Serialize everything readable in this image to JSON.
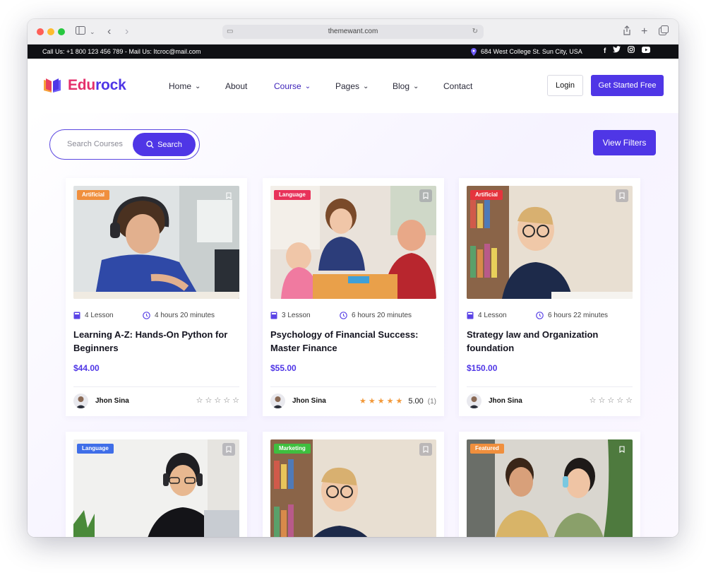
{
  "browser": {
    "url": "themewant.com"
  },
  "topbar": {
    "contact": "Call Us: +1 800 123 456 789 - Mail Us: Itcroc@mail.com",
    "address": "684 West College St. Sun City, USA",
    "social": [
      "f",
      "t",
      "ig",
      "yt"
    ]
  },
  "logo": {
    "text_a": "Edu",
    "text_b": "rock",
    "color_a": "#e42f6b",
    "color_b": "#4f36e6"
  },
  "nav": [
    {
      "label": "Home",
      "dropdown": true
    },
    {
      "label": "About",
      "dropdown": false
    },
    {
      "label": "Course",
      "dropdown": true,
      "active": true
    },
    {
      "label": "Pages",
      "dropdown": true
    },
    {
      "label": "Blog",
      "dropdown": true
    },
    {
      "label": "Contact",
      "dropdown": false
    }
  ],
  "header": {
    "login": "Login",
    "get_started": "Get Started Free"
  },
  "search": {
    "placeholder": "Search Courses",
    "button": "Search"
  },
  "view_filters": "View Filters",
  "colors": {
    "accent": "#4f36e6",
    "star": "#f2993a"
  },
  "courses": [
    {
      "badge": "Artificial",
      "badge_color": "#f08f3d",
      "lessons": "4 Lesson",
      "duration": "4 hours  20 minutes",
      "title": "Learning A-Z: Hands-On Python for Beginners",
      "price": "$44.00",
      "author": "Jhon Sina",
      "stars": 0,
      "rating": "",
      "reviews": ""
    },
    {
      "badge": "Language",
      "badge_color": "#e8325a",
      "lessons": "3 Lesson",
      "duration": "6 hours  20 minutes",
      "title": "Psychology of Financial Success: Master Finance",
      "price": "$55.00",
      "author": "Jhon Sina",
      "stars": 5,
      "rating": "5.00",
      "reviews": "(1)"
    },
    {
      "badge": "Artificial",
      "badge_color": "#e5343d",
      "lessons": "4 Lesson",
      "duration": "6 hours  22 minutes",
      "title": "Strategy law and Organization foundation",
      "price": "$150.00",
      "author": "Jhon Sina",
      "stars": 0,
      "rating": "",
      "reviews": ""
    },
    {
      "badge": "Language",
      "badge_color": "#3f6ee8"
    },
    {
      "badge": "Marketing",
      "badge_color": "#3fbf3f"
    },
    {
      "badge": "Featured",
      "badge_color": "#f08f3d"
    }
  ]
}
